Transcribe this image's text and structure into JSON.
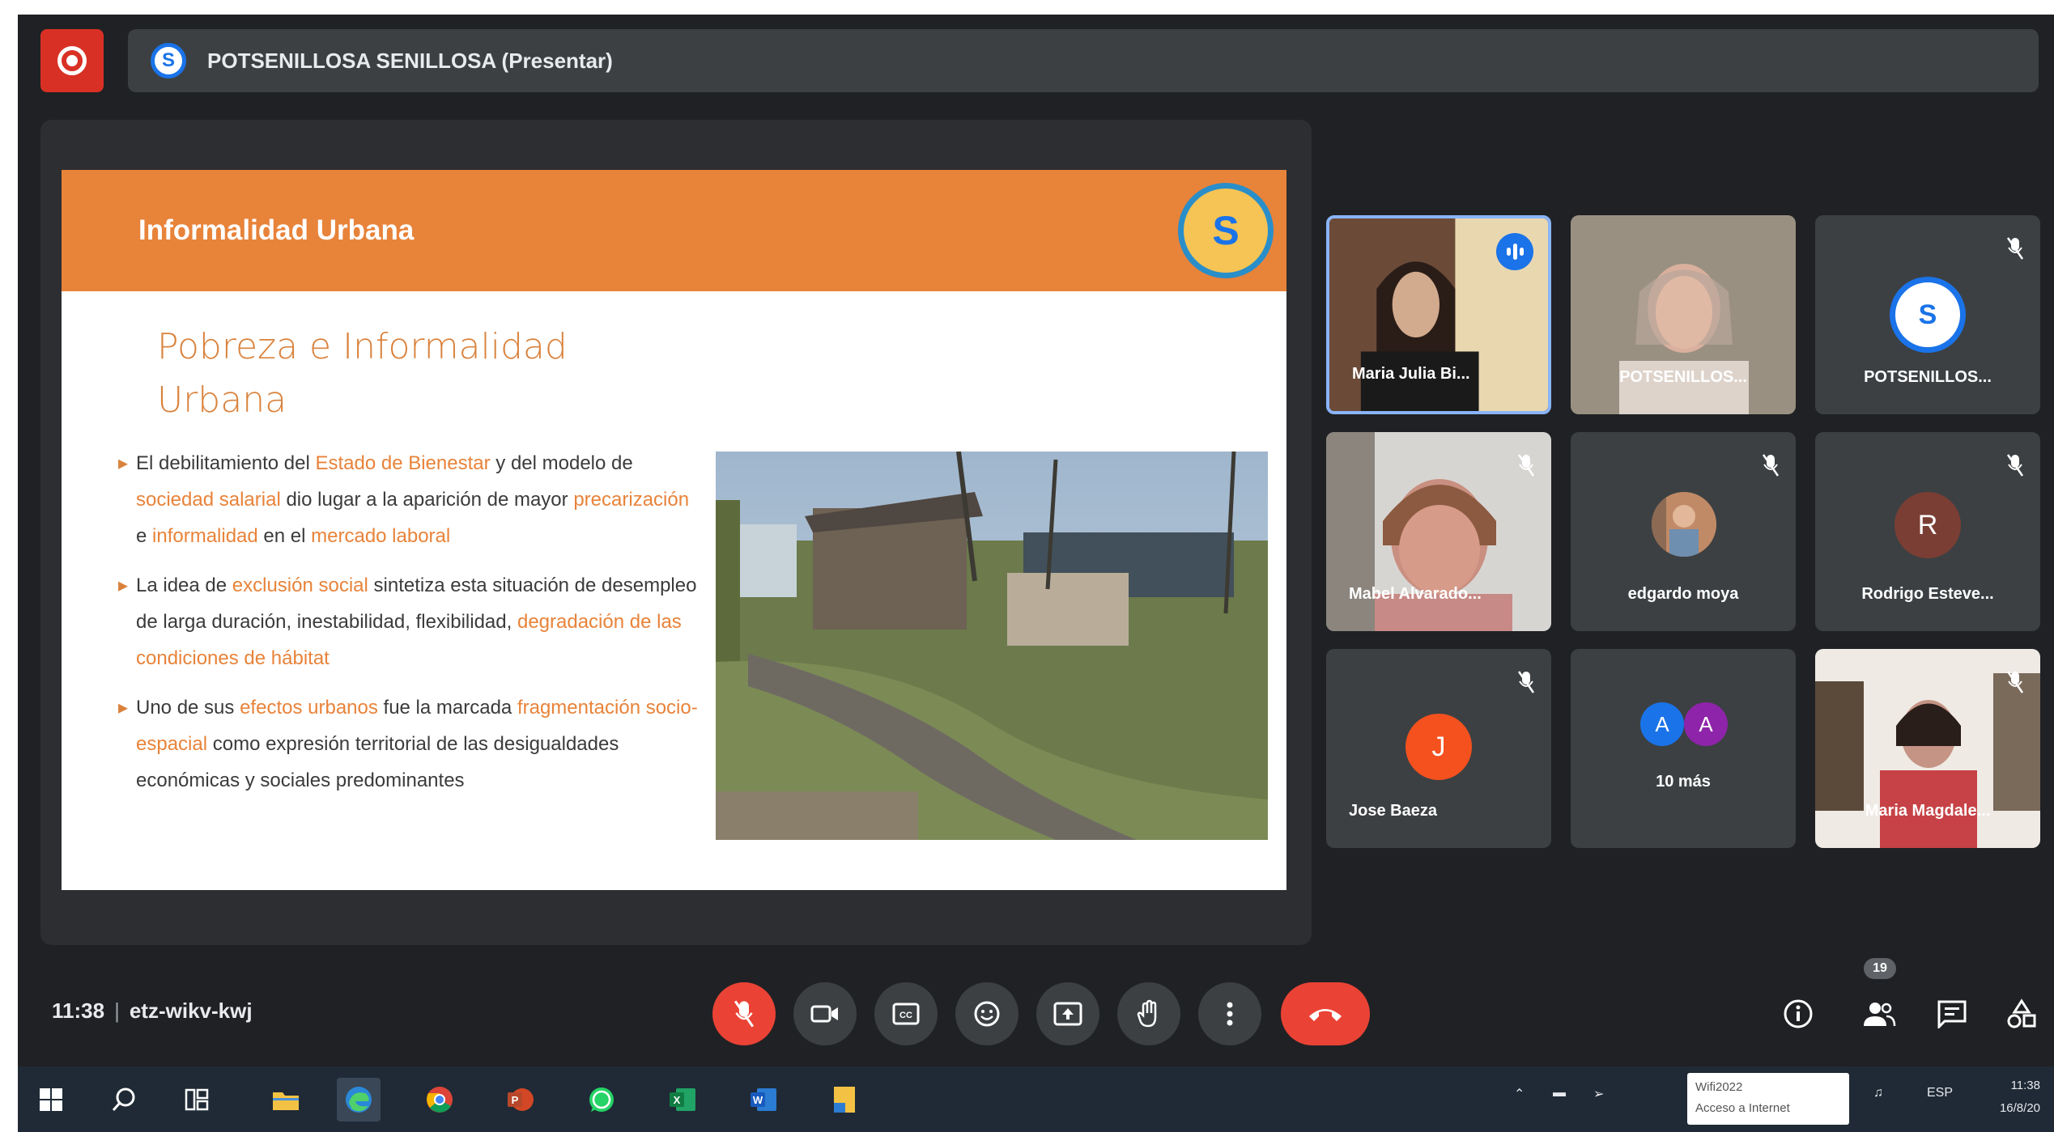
{
  "presenter_bar": {
    "title": "POTSENILLOSA SENILLOSA (Presentar)"
  },
  "slide": {
    "title": "Informalidad Urbana",
    "subtitle_line1": "Pobreza e Informalidad",
    "subtitle_line2": "Urbana",
    "bullets": [
      {
        "html": "El debilitamiento del <span class=\"hl\">Estado de Bienestar</span> y del modelo de <span class=\"hl\">sociedad salarial</span> dio lugar a la aparición de mayor <span class=\"hl\">precarización</span> e <span class=\"hl\">informalidad</span> en el <span class=\"hl\">mercado laboral</span>"
      },
      {
        "html": "La idea de <span class=\"hl\">exclusión social</span> sintetiza esta situación de desempleo de larga duración, inestabilidad, flexibilidad, <span class=\"hl\">degradación de las condiciones de hábitat</span>"
      },
      {
        "html": "Uno de sus <span class=\"hl\">efectos urbanos</span> fue la marcada <span class=\"hl\">fragmentación socio-espacial</span> como expresión territorial de las desigualdades económicas y sociales predominantes"
      }
    ]
  },
  "participants": [
    {
      "name": "Maria Julia Bi...",
      "speaking": true
    },
    {
      "name": "POTSENILLOS..."
    },
    {
      "name": "POTSENILLOS...",
      "muted": true
    },
    {
      "name": "Mabel Alvarado...",
      "muted": true
    },
    {
      "name": "edgardo moya",
      "muted": true
    },
    {
      "name": "Rodrigo Esteve...",
      "initial": "R",
      "muted": true
    },
    {
      "name": "Jose Baeza",
      "initial": "J",
      "muted": true
    },
    {
      "name": "10 más",
      "initials": [
        "A",
        "A"
      ]
    },
    {
      "name": "Maria Magdale...",
      "muted": true
    }
  ],
  "meeting": {
    "time": "11:38",
    "code": "etz-wikv-kwj",
    "participant_count": "19"
  },
  "colors": {
    "accent_orange": "#e8833a",
    "end_red": "#ea4335",
    "meet_bg": "#202124",
    "tile_bg": "#3c4043"
  },
  "taskbar": {
    "wifi_line1": "Wifi2022",
    "wifi_line2": "Acceso a Internet",
    "lang": "ESP",
    "time": "11:38",
    "date": "16/8/20"
  }
}
